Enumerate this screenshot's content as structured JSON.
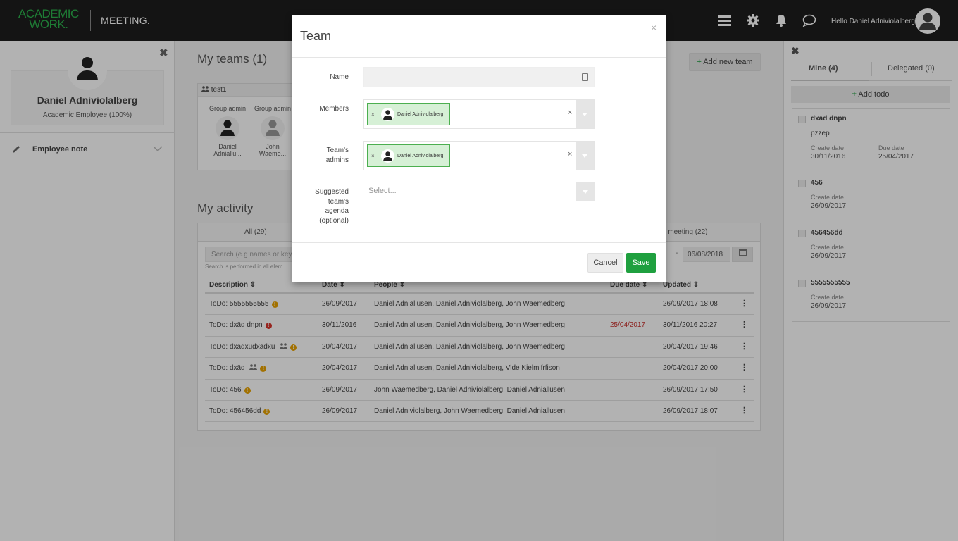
{
  "header": {
    "logo_line1": "ACADEMIC",
    "logo_line2": "WORK.",
    "app_name": "MEETING.",
    "greeting": "Hello Daniel Adniviolalberg!",
    "icons": [
      "menu-icon",
      "gear-icon",
      "bell-icon",
      "chat-icon"
    ]
  },
  "left_sidebar": {
    "name": "Daniel Adniviolalberg",
    "role": "Academic Employee (100%)",
    "employee_note_label": "Employee note"
  },
  "main": {
    "my_teams_title": "My teams (1)",
    "add_team_label": "Add new team",
    "team": {
      "name": "test1",
      "members": [
        {
          "role": "Group admin",
          "name_line1": "Daniel",
          "name_line2": "Adniallu..."
        },
        {
          "role": "Group admin",
          "name_line1": "John",
          "name_line2": "Waeme..."
        }
      ]
    },
    "activity_title": "My activity",
    "activity_tabs": [
      "All (29)",
      "n meeting (22)"
    ],
    "search_placeholder": "Search (e.g names or key",
    "search_hint": "Search is performed in all elem",
    "date_to": "06/08/2018",
    "columns": [
      "Description",
      "Date",
      "People",
      "Due date",
      "Updated"
    ],
    "rows": [
      {
        "desc": "ToDo: 5555555555",
        "date": "26/09/2017",
        "people": "Daniel Adniallusen, Daniel Adniviolalberg, John Waemedberg",
        "due": "",
        "updated": "26/09/2017 18:08"
      },
      {
        "desc": "ToDo: dxäd dnpn",
        "date": "30/11/2016",
        "people": "Daniel Adniallusen, Daniel Adniviolalberg, John Waemedberg",
        "due": "25/04/2017",
        "updated": "30/11/2016 20:27"
      },
      {
        "desc": "ToDo: dxädxudxädxu",
        "date": "20/04/2017",
        "people": "Daniel Adniallusen, Daniel Adniviolalberg, John Waemedberg",
        "due": "",
        "updated": "20/04/2017 19:46"
      },
      {
        "desc": "ToDo: dxäd",
        "date": "20/04/2017",
        "people": "Daniel Adniallusen, Daniel Adniviolalberg, Vide Kielmifrfison",
        "due": "",
        "updated": "20/04/2017 20:00"
      },
      {
        "desc": "ToDo: 456",
        "date": "26/09/2017",
        "people": "John Waemedberg, Daniel Adniviolalberg, Daniel Adniallusen",
        "due": "",
        "updated": "26/09/2017 17:50"
      },
      {
        "desc": "ToDo: 456456dd",
        "date": "26/09/2017",
        "people": "Daniel Adniviolalberg, John Waemedberg, Daniel Adniallusen",
        "due": "",
        "updated": "26/09/2017 18:07"
      }
    ]
  },
  "right_panel": {
    "tab_mine": "Mine (4)",
    "tab_delegated": "Delegated (0)",
    "add_todo": "Add todo",
    "create_label": "Create date",
    "due_label": "Due date",
    "todos": [
      {
        "title": "dxäd dnpn",
        "sub": "pzzep",
        "create": "30/11/2016",
        "due": "25/04/2017"
      },
      {
        "title": "456",
        "create": "26/09/2017"
      },
      {
        "title": "456456dd",
        "create": "26/09/2017"
      },
      {
        "title": "5555555555",
        "create": "26/09/2017"
      }
    ]
  },
  "modal": {
    "title": "Team",
    "labels": {
      "name": "Name",
      "members": "Members",
      "admins_line1": "Team's",
      "admins_line2": "admins",
      "agenda_line1": "Suggested",
      "agenda_line2": "team's",
      "agenda_line3": "agenda",
      "agenda_line4": "(optional)"
    },
    "name_value": "",
    "member_chip": "Daniel Adniviolalberg",
    "admin_chip": "Daniel Adniviolalberg",
    "agenda_placeholder": "Select...",
    "cancel_label": "Cancel",
    "save_label": "Save"
  },
  "colors": {
    "brand_green": "#2bb24c",
    "save_green": "#1fa03f",
    "overdue_red": "#c9302c",
    "warn_orange": "#e8a200"
  }
}
